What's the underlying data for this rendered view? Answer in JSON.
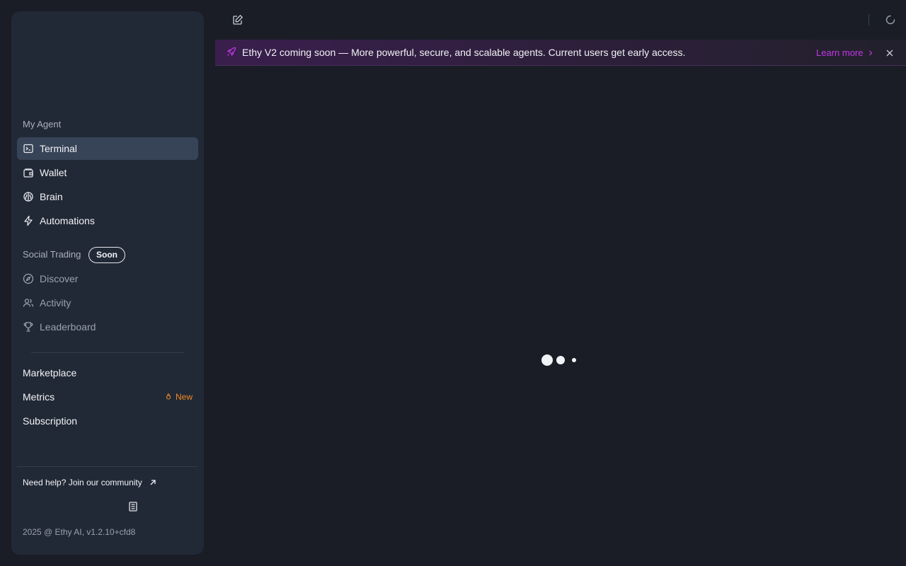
{
  "sidebar": {
    "my_agent_label": "My Agent",
    "agent_items": [
      {
        "label": "Terminal",
        "icon": "terminal-icon",
        "active": true
      },
      {
        "label": "Wallet",
        "icon": "wallet-icon"
      },
      {
        "label": "Brain",
        "icon": "brain-icon"
      },
      {
        "label": "Automations",
        "icon": "zap-icon"
      }
    ],
    "social_label": "Social Trading",
    "soon_badge": "Soon",
    "social_items": [
      {
        "label": "Discover",
        "icon": "compass-icon"
      },
      {
        "label": "Activity",
        "icon": "users-icon"
      },
      {
        "label": "Leaderboard",
        "icon": "trophy-icon"
      }
    ],
    "other_items": [
      {
        "label": "Marketplace"
      },
      {
        "label": "Metrics",
        "tag": "New"
      },
      {
        "label": "Subscription"
      }
    ],
    "help_text": "Need help? Join our community",
    "version": "2025 @ Ethy AI, v1.2.10+cfd8"
  },
  "banner": {
    "text": "Ethy V2 coming soon — More powerful, secure, and scalable agents. Current users get early access.",
    "learn_more": "Learn more"
  },
  "colors": {
    "background": "#1a1d26",
    "sidebar": "#222936",
    "active_item": "#374357",
    "accent_purple": "#c238e8",
    "new_orange": "#f08a24"
  }
}
